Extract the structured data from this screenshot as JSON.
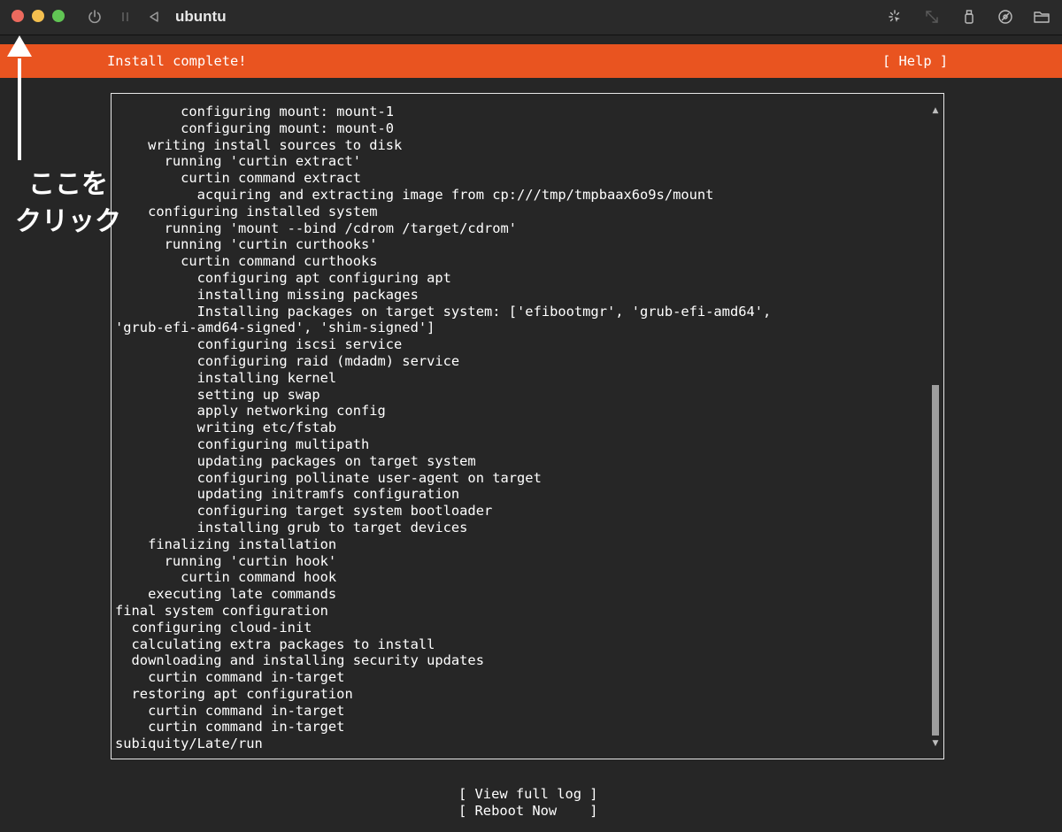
{
  "window": {
    "title": "ubuntu",
    "controls": [
      "close-button",
      "minimize-button",
      "maximize-button"
    ],
    "toolbar_icons": [
      "power-icon",
      "pause-icon",
      "back-icon",
      "capture-input-icon",
      "resize-icon",
      "usb-icon",
      "shared-disk-icon",
      "shared-folder-icon"
    ]
  },
  "installer": {
    "header_title": "Install complete!",
    "help_label": "[ Help ]",
    "header_color": "#e95420",
    "log_lines": [
      "        configuring mount: mount-1",
      "        configuring mount: mount-0",
      "    writing install sources to disk",
      "      running 'curtin extract'",
      "        curtin command extract",
      "          acquiring and extracting image from cp:///tmp/tmpbaax6o9s/mount",
      "    configuring installed system",
      "      running 'mount --bind /cdrom /target/cdrom'",
      "      running 'curtin curthooks'",
      "        curtin command curthooks",
      "          configuring apt configuring apt",
      "          installing missing packages",
      "          Installing packages on target system: ['efibootmgr', 'grub-efi-amd64',",
      "'grub-efi-amd64-signed', 'shim-signed']",
      "          configuring iscsi service",
      "          configuring raid (mdadm) service",
      "          installing kernel",
      "          setting up swap",
      "          apply networking config",
      "          writing etc/fstab",
      "          configuring multipath",
      "          updating packages on target system",
      "          configuring pollinate user-agent on target",
      "          updating initramfs configuration",
      "          configuring target system bootloader",
      "          installing grub to target devices",
      "    finalizing installation",
      "      running 'curtin hook'",
      "        curtin command hook",
      "    executing late commands",
      "final system configuration",
      "  configuring cloud-init",
      "  calculating extra packages to install",
      "  downloading and installing security updates",
      "    curtin command in-target",
      "  restoring apt configuration",
      "    curtin command in-target",
      "    curtin command in-target",
      "subiquity/Late/run"
    ],
    "view_log_label": "[ View full log ]",
    "reboot_label": "[ Reboot Now    ]"
  },
  "annotation": {
    "line1": "ここを",
    "line2": "クリック",
    "arrow_color": "#ffffff"
  }
}
